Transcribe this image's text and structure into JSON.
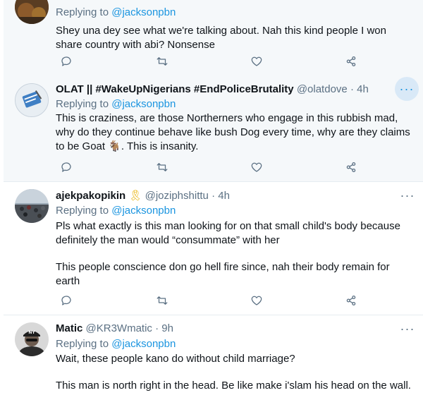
{
  "tweets": [
    {
      "replying_prefix": "Replying to",
      "replying_handle": "@jacksonpbn",
      "text": [
        "Shey una dey see what we're talking about. Nah this kind people I won share country with abi? Nonsense"
      ]
    },
    {
      "name": "OLAT || #WakeUpNigerians #EndPoliceBrutality",
      "handle": "@olatdove",
      "sep": "·",
      "time": "4h",
      "replying_prefix": "Replying to",
      "replying_handle": "@jacksonpbn",
      "text": [
        "This is craziness, are those Northerners who engage in this rubbish mad, why do they continue behave like bush Dog every time, why are they claims to be Goat 🐐. This is insanity."
      ]
    },
    {
      "name": "ajekpakopikin",
      "badge": "🎗",
      "handle": "@joziphshittu",
      "sep": "·",
      "time": "4h",
      "replying_prefix": "Replying to",
      "replying_handle": "@jacksonpbn",
      "text": [
        "Pls what exactly is this man looking for on that small child's body because definitely the man would “consummate” with her",
        "This people conscience don go hell fire since, nah their body remain for earth"
      ]
    },
    {
      "name": "Matic",
      "handle": "@KR3Wmatic",
      "sep": "·",
      "time": "9h",
      "replying_prefix": "Replying to",
      "replying_handle": "@jacksonpbn",
      "text": [
        "Wait, these people kano do without child marriage?",
        "This man is north right in the head. Be like make i'slam his head on the wall."
      ]
    }
  ],
  "more_glyph": "···",
  "icons": [
    "reply-icon",
    "retweet-icon",
    "like-icon",
    "share-icon",
    "more-icon"
  ],
  "colors": {
    "link": "#1b95e0",
    "muted": "#5b7083",
    "highlight_bg": "#f5f8fa",
    "more_active_bg": "#d9e9f7"
  }
}
